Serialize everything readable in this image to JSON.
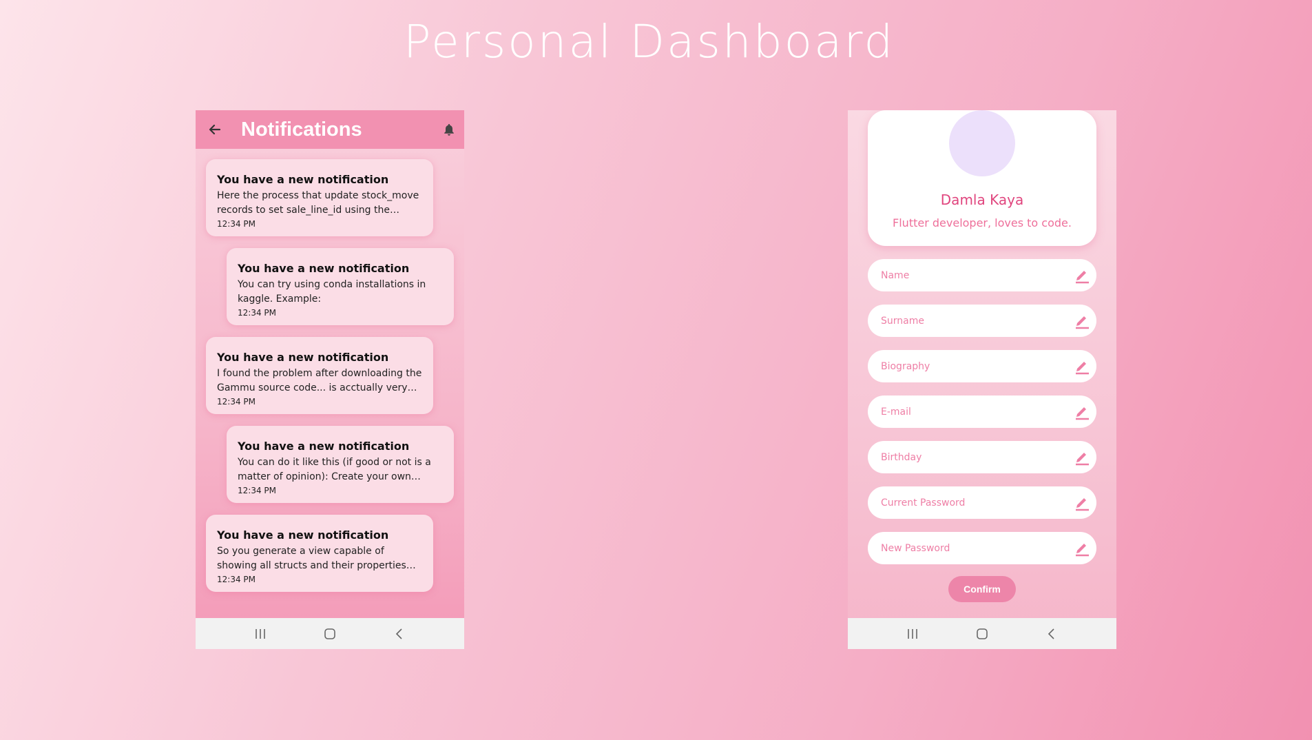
{
  "page": {
    "title": "Personal Dashboard"
  },
  "notifications_screen": {
    "appbar": {
      "title": "Notifications",
      "back_icon": "arrow-left-icon",
      "bell_icon": "bell-icon"
    },
    "items": [
      {
        "title": "You have a new notification",
        "body": "Here the process that update stock_move records to set sale_line_id using the _prepare_procurement_values...",
        "time": "12:34 PM"
      },
      {
        "title": "You have a new notification",
        "body": "You can try using conda installations in kaggle. Example:",
        "time": "12:34 PM"
      },
      {
        "title": "You have a new notification",
        "body": "I found the problem after downloading the Gammu source code... is acctually very simple...",
        "time": "12:34 PM"
      },
      {
        "title": "You have a new notification",
        "body": "You can do it like this (if good or not is a matter of opinion): Create your own converter...",
        "time": "12:34 PM"
      },
      {
        "title": "You have a new notification",
        "body": "So you generate a view capable of showing all structs and their properties recursively. ...",
        "time": "12:34 PM"
      }
    ]
  },
  "profile_screen": {
    "name": "Damla Kaya",
    "bio": "Flutter developer, loves to code.",
    "fields": [
      "Name",
      "Surname",
      "Biography",
      "E-mail",
      "Birthday",
      "Current Password",
      "New Password"
    ],
    "edit_icon": "pencil-icon",
    "confirm_label": "Confirm"
  },
  "system_nav": {
    "icons": [
      "recent-apps-icon",
      "home-icon",
      "back-chevron-icon"
    ]
  },
  "colors": {
    "accent": "#f291b1",
    "accent_text": "#e0457e",
    "field_label": "#ee7ea5",
    "confirm_bg": "#ed85a9"
  }
}
